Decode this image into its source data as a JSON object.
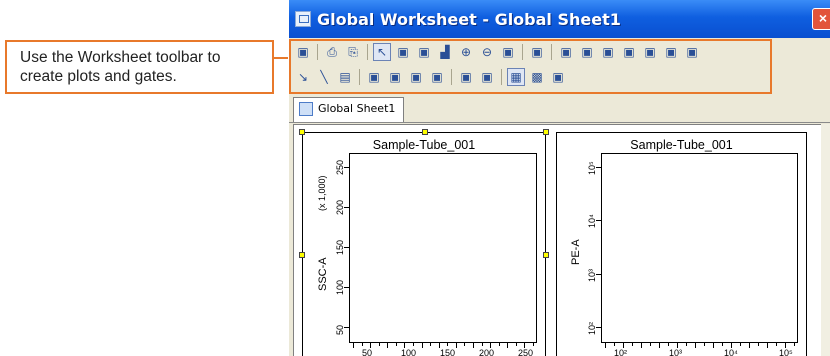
{
  "callout": {
    "line1": "Use the Worksheet toolbar to",
    "line2": "create plots and gates."
  },
  "window": {
    "title": "Global Worksheet - Global Sheet1",
    "close_label": "×"
  },
  "tabs": [
    {
      "label": "Global Sheet1"
    }
  ],
  "plots": [
    {
      "title": "Sample-Tube_001",
      "ylabel": "SSC-A",
      "yscale_label": "(x 1,000)",
      "yticks": [
        "250",
        "200",
        "150",
        "100",
        "50"
      ],
      "xticks": [
        "50",
        "100",
        "150",
        "200",
        "250"
      ]
    },
    {
      "title": "Sample-Tube_001",
      "ylabel": "PE-A",
      "yticks": [
        "10⁵",
        "10⁴",
        "10³",
        "10²"
      ],
      "xticks": [
        "10²",
        "10³",
        "10⁴",
        "10⁵"
      ]
    }
  ],
  "toolbar": {
    "row1_icons": [
      "worksheet-icon",
      "print-icon",
      "pdf-icon",
      "pointer-icon",
      "dot-plot-icon",
      "contour-plot-icon",
      "histogram-icon",
      "zoom-in-icon",
      "zoom-out-icon",
      "stats-view-icon",
      "population-hierarchy-icon",
      "snap-to-gate-icon",
      "rectangle-gate-icon",
      "polygon-gate-icon",
      "quadrant-gate-icon",
      "interval-gate-icon",
      "histogram-gate-icon",
      "bi-exponential-icon"
    ],
    "row2_icons": [
      "line-icon",
      "diagonal-line-icon",
      "text-box-icon",
      "align-left-icon",
      "align-right-icon",
      "align-top-icon",
      "align-bottom-icon",
      "distribute-horizontal-icon",
      "distribute-vertical-icon",
      "grid-icon",
      "show-grid-icon",
      "snap-grid-icon"
    ]
  }
}
